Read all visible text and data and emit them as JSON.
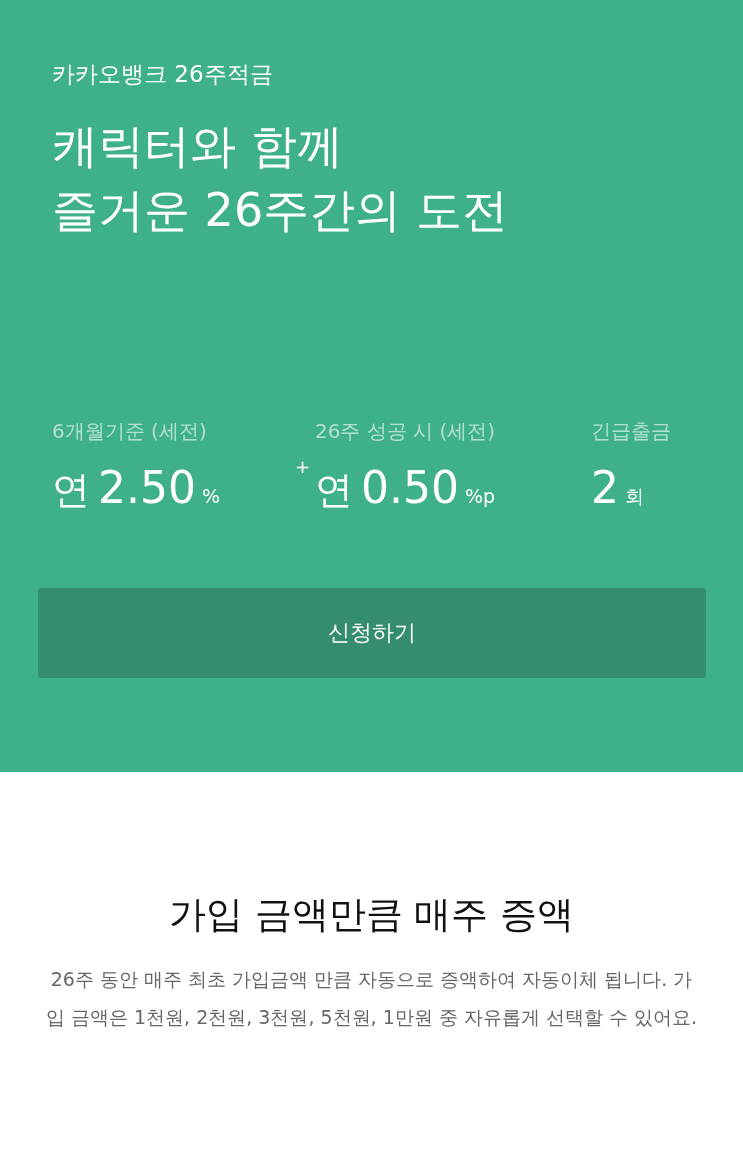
{
  "hero": {
    "eyebrow": "카카오뱅크 26주적금",
    "headline": [
      "캐릭터와 함께",
      "즐거운 26주간의 도전"
    ],
    "stats": [
      {
        "label": "6개월기준 (세전)",
        "prefix": "연",
        "value": "2.50",
        "unit": "%"
      },
      {
        "label": "26주 성공 시 (세전)",
        "plus": "+",
        "prefix": "연",
        "value": "0.50",
        "unit": "%p"
      },
      {
        "label": "긴급출금",
        "value": "2",
        "unit": "회"
      }
    ],
    "button": "신청하기"
  },
  "feature": {
    "title": "가입 금액만큼 매주 증액",
    "description": "26주 동안 매주 최초 가입금액 만큼 자동으로 증액하여 자동이체 됩니다. 가입 금액은 1천원, 2천원, 3천원, 5천원, 1만원 중 자유롭게 선택할 수 있어요."
  }
}
